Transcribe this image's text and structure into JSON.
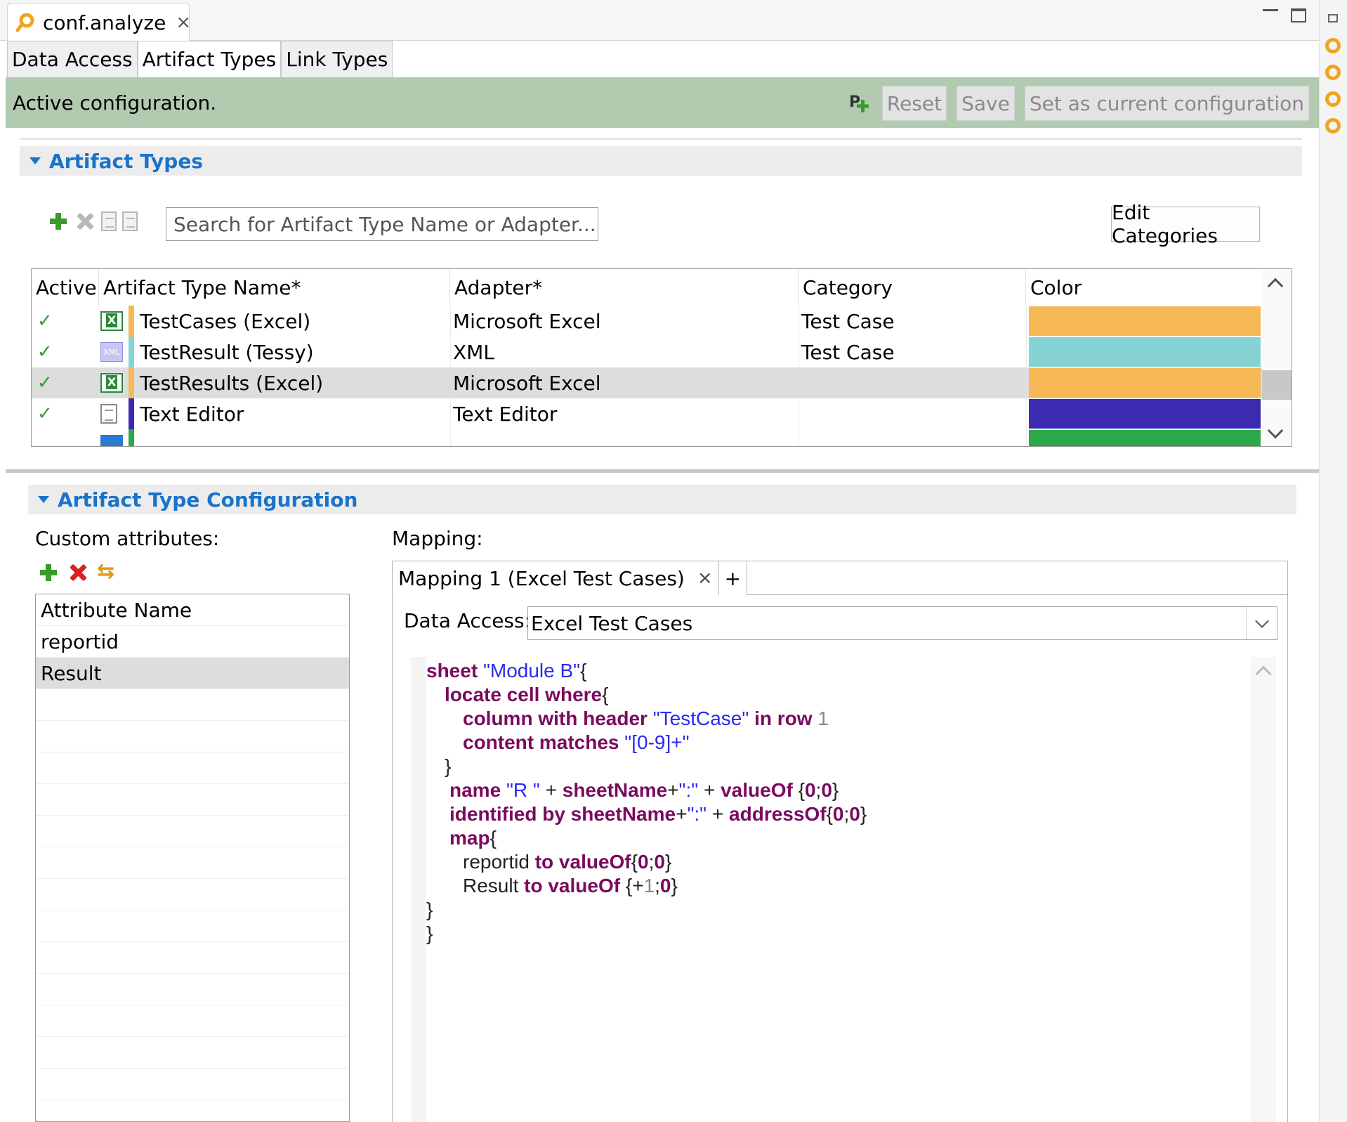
{
  "editor": {
    "tab_title": "conf.analyze",
    "close_glyph": "×"
  },
  "sub_tabs": [
    "Data Access",
    "Artifact Types",
    "Link Types"
  ],
  "status": {
    "text": "Active configuration.",
    "reset_label": "Reset",
    "save_label": "Save",
    "set_current_label": "Set as current configuration"
  },
  "artifact_types": {
    "section_title": "Artifact Types",
    "search_placeholder": "Search for Artifact Type Name or Adapter...",
    "edit_categories_label": "Edit Categories",
    "columns": [
      "Active",
      "Artifact Type Name*",
      "Adapter*",
      "Category",
      "Color"
    ],
    "rows": [
      {
        "active": "✓",
        "icon": "excel-icon",
        "name": "TestCases (Excel)",
        "adapter": "Microsoft Excel",
        "category": "Test Case",
        "color": "#F7B955",
        "selected": false
      },
      {
        "active": "✓",
        "icon": "xml-icon",
        "name": "TestResult (Tessy)",
        "adapter": "XML",
        "category": "Test Case",
        "color": "#86D3D3",
        "selected": false
      },
      {
        "active": "✓",
        "icon": "excel-icon",
        "name": "TestResults (Excel)",
        "adapter": "Microsoft Excel",
        "category": "",
        "color": "#F7B955",
        "selected": true
      },
      {
        "active": "✓",
        "icon": "text-file-icon",
        "name": "Text Editor",
        "adapter": "Text Editor",
        "category": "",
        "color": "#3A2BB1",
        "selected": false
      }
    ]
  },
  "artifact_type_config": {
    "section_title": "Artifact Type Configuration",
    "custom_attributes_label": "Custom attributes:",
    "attribute_header": "Attribute Name",
    "attributes": [
      "reportid",
      "Result"
    ],
    "mapping_label": "Mapping:",
    "mapping_tab": "Mapping 1 (Excel Test Cases)",
    "mapping_tab_close": "×",
    "add_tab_label": "+",
    "data_access_label": "Data Access:",
    "data_access_value": "Excel Test Cases"
  },
  "code": {
    "l1": {
      "kw1": "sheet ",
      "str1": "\"Module B\"",
      "pl1": "{"
    },
    "l2": {
      "kw1": "locate cell where",
      "pl1": "{"
    },
    "l3": {
      "kw1": "column with header ",
      "str1": "\"TestCase\"",
      "kw2": " in row ",
      "num1": "1"
    },
    "l4": {
      "kw1": "content matches ",
      "str1": "\"[0-9]+\""
    },
    "l5": {
      "pl1": "}"
    },
    "l6": {
      "kw1": "name ",
      "str1": "\"R \"",
      "pl1": " + ",
      "kw2": "sheetName",
      "pl2": "+",
      "str2": "\":\"",
      "pl3": " + ",
      "kw3": "valueOf ",
      "pl4": "{",
      "kw4": "0",
      "pl5": ";",
      "kw5": "0",
      "pl6": "}"
    },
    "l7": {
      "kw1": "identified by sheetName",
      "pl1": "+",
      "str1": "\":\"",
      "pl2": " + ",
      "kw2": "addressOf",
      "pl3": "{",
      "kw3": "0",
      "pl4": ";",
      "kw4": "0",
      "pl5": "}"
    },
    "l8": {
      "kw1": "map",
      "pl1": "{"
    },
    "l9": {
      "pl1": "reportid ",
      "kw1": "to valueOf",
      "pl2": "{",
      "kw2": "0",
      "pl3": ";",
      "kw3": "0",
      "pl4": "}"
    },
    "l10": {
      "pl1": "Result ",
      "kw1": "to valueOf ",
      "pl2": "{+",
      "num1": "1",
      "pl3": ";",
      "kw2": "0",
      "pl4": "}"
    },
    "l11": {
      "pl1": "}"
    },
    "l12": {
      "pl1": "}"
    }
  }
}
